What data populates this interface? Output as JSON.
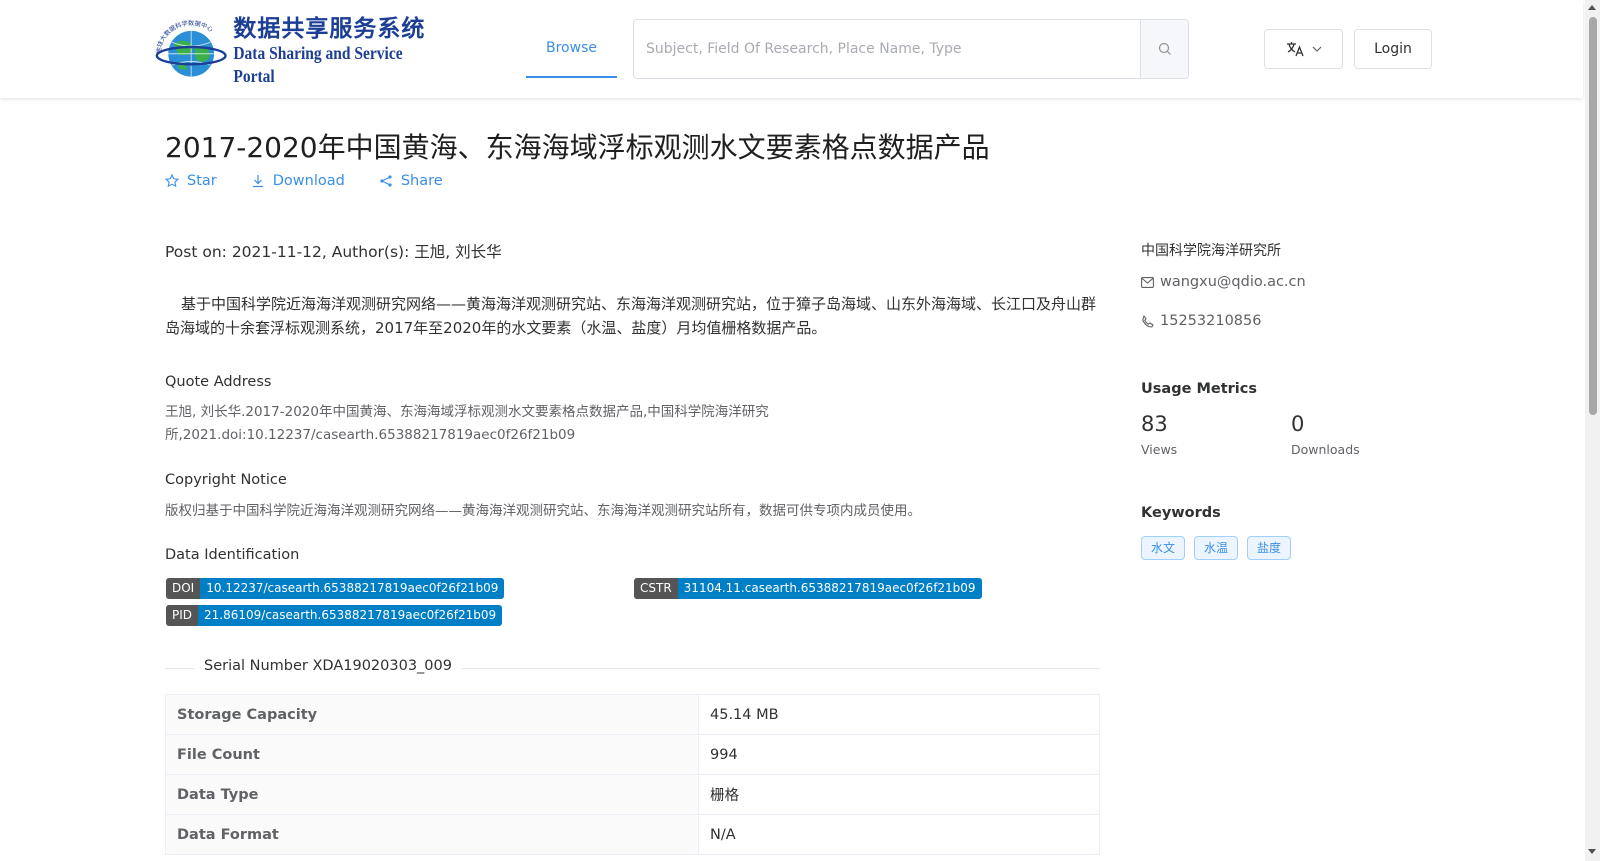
{
  "header": {
    "logo_cn": "数据共享服务系统",
    "logo_en": "Data Sharing and Service Portal",
    "logo_ring_text": "地球大数据科学数据中心",
    "nav_browse": "Browse",
    "search_placeholder": "Subject, Field Of Research, Place Name, Type",
    "login_label": "Login",
    "language_icon": "translate-icon"
  },
  "dataset": {
    "title": "2017-2020年中国黄海、东海海域浮标观测水文要素格点数据产品",
    "actions": {
      "star": "Star",
      "download": "Download",
      "share": "Share"
    },
    "meta_line": "Post on: 2021-11-12, Author(s): 王旭, 刘长华",
    "description": "基于中国科学院近海海洋观测研究网络——黄海海洋观测研究站、东海海洋观测研究站，位于獐子岛海域、山东外海海域、长江口及舟山群岛海域的十余套浮标观测系统，2017年至2020年的水文要素（水温、盐度）月均值栅格数据产品。",
    "quote": {
      "title": "Quote Address",
      "text": "王旭, 刘长华.2017-2020年中国黄海、东海海域浮标观测水文要素格点数据产品,中国科学院海洋研究所,2021.doi:10.12237/casearth.65388217819aec0f26f21b09"
    },
    "copyright": {
      "title": "Copyright Notice",
      "text": "版权归基于中国科学院近海海洋观测研究网络——黄海海洋观测研究站、东海海洋观测研究站所有，数据可供专项内成员使用。"
    },
    "identification": {
      "title": "Data Identification",
      "doi_key": "DOI",
      "doi": "10.12237/casearth.65388217819aec0f26f21b09",
      "cstr_key": "CSTR",
      "cstr": "31104.11.casearth.65388217819aec0f26f21b09",
      "pid_key": "PID",
      "pid": "21.86109/casearth.65388217819aec0f26f21b09"
    },
    "serial_number": "Serial Number XDA19020303_009",
    "table": [
      {
        "label": "Storage Capacity",
        "value": "45.14 MB"
      },
      {
        "label": "File Count",
        "value": "994"
      },
      {
        "label": "Data Type",
        "value": "栅格"
      },
      {
        "label": "Data Format",
        "value": "N/A"
      }
    ]
  },
  "sidebar": {
    "org": "中国科学院海洋研究所",
    "email": "wangxu@qdio.ac.cn",
    "phone": "15253210856",
    "metrics_title": "Usage Metrics",
    "views": "83",
    "views_label": "Views",
    "downloads": "0",
    "downloads_label": "Downloads",
    "keywords_title": "Keywords",
    "keywords": [
      "水文",
      "水温",
      "盐度"
    ]
  },
  "colors": {
    "accent": "#3a8ee6",
    "badge_key": "#555555",
    "badge_value": "#007ec6",
    "logo": "#1c3f95"
  }
}
